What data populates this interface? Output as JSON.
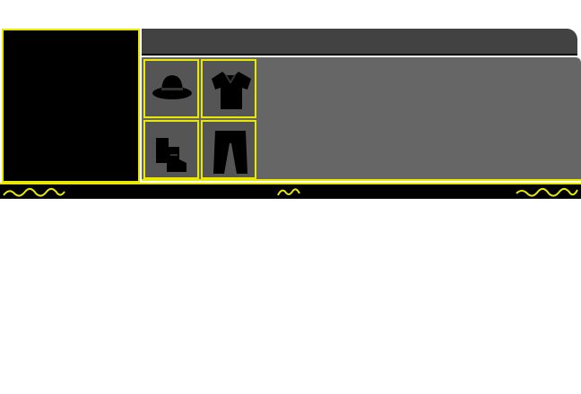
{
  "panel": {
    "colors": {
      "accent": "#e8e800",
      "preview_bg": "#000000",
      "top_bar": "#424242",
      "content_bg": "#666666",
      "slot_bg": "#555555"
    },
    "equipment_slots": [
      {
        "icon": "hat-icon"
      },
      {
        "icon": "shirt-icon"
      },
      {
        "icon": "boots-icon"
      },
      {
        "icon": "pants-icon"
      }
    ],
    "decorations": [
      "squiggle-left-icon",
      "squiggle-center-icon",
      "squiggle-right-icon"
    ]
  }
}
